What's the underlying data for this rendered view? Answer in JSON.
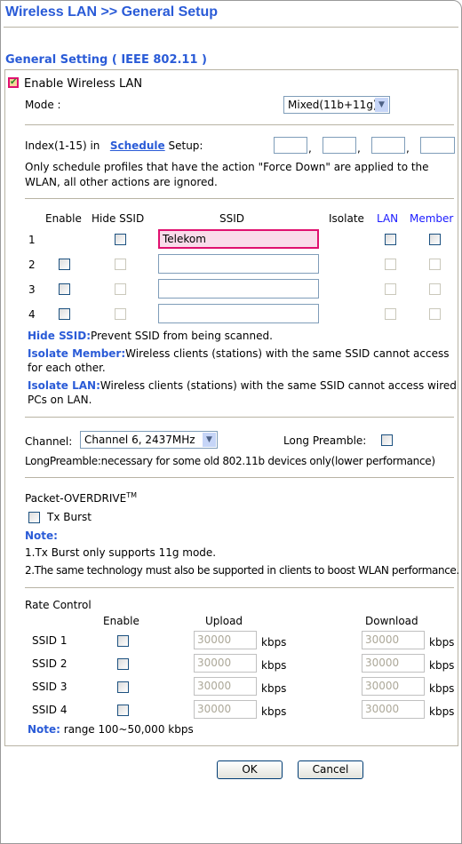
{
  "title": "Wireless LAN >> General Setup",
  "section": "General Setting ( IEEE 802.11 )",
  "enable_wlan": {
    "label": "Enable Wireless LAN",
    "checked": true
  },
  "mode": {
    "label": "Mode :",
    "value": "Mixed(11b+11g)"
  },
  "schedule": {
    "prefix": "Index(1-15) in",
    "link": "Schedule",
    "suffix": "Setup:",
    "note": "Only schedule profiles that have the action \"Force Down\" are applied to the WLAN, all other actions are ignored.",
    "values": [
      "",
      "",
      "",
      ""
    ]
  },
  "ssid_table": {
    "headers": {
      "enable": "Enable",
      "hide": "Hide SSID",
      "ssid": "SSID",
      "isolate": "Isolate",
      "lan": "LAN",
      "member": "Member"
    },
    "rows": [
      {
        "index": "1",
        "ssid": "Telekom"
      },
      {
        "index": "2",
        "ssid": ""
      },
      {
        "index": "3",
        "ssid": ""
      },
      {
        "index": "4",
        "ssid": ""
      }
    ]
  },
  "notes": {
    "hide_label": "Hide SSID:",
    "hide_text": "Prevent SSID from being scanned.",
    "member_label": "Isolate Member:",
    "member_text": "Wireless clients (stations) with the same SSID cannot access for each other.",
    "lan_label": "Isolate LAN:",
    "lan_text": "Wireless clients (stations) with the same SSID cannot access wired PCs on LAN."
  },
  "channel": {
    "label": "Channel:",
    "value": "Channel 6, 2437MHz",
    "preamble_label": "Long Preamble:",
    "preamble_note": "LongPreamble:necessary for some old 802.11b devices only(lower performance)"
  },
  "overdrive": {
    "title": "Packet-OVERDRIVE",
    "tm": "TM",
    "tx_burst": "Tx Burst",
    "note_label": "Note:",
    "note1": "1.Tx Burst only supports 11g mode.",
    "note2": "2.The same technology must also be supported in clients to boost WLAN performance."
  },
  "rate": {
    "title": "Rate Control",
    "enable": "Enable",
    "upload": "Upload",
    "download": "Download",
    "unit": "kbps",
    "rows": [
      {
        "name": "SSID 1",
        "up": "30000",
        "down": "30000"
      },
      {
        "name": "SSID 2",
        "up": "30000",
        "down": "30000"
      },
      {
        "name": "SSID 3",
        "up": "30000",
        "down": "30000"
      },
      {
        "name": "SSID 4",
        "up": "30000",
        "down": "30000"
      }
    ],
    "note_label": "Note:",
    "note_text": "range 100~50,000 kbps"
  },
  "buttons": {
    "ok": "OK",
    "cancel": "Cancel"
  }
}
